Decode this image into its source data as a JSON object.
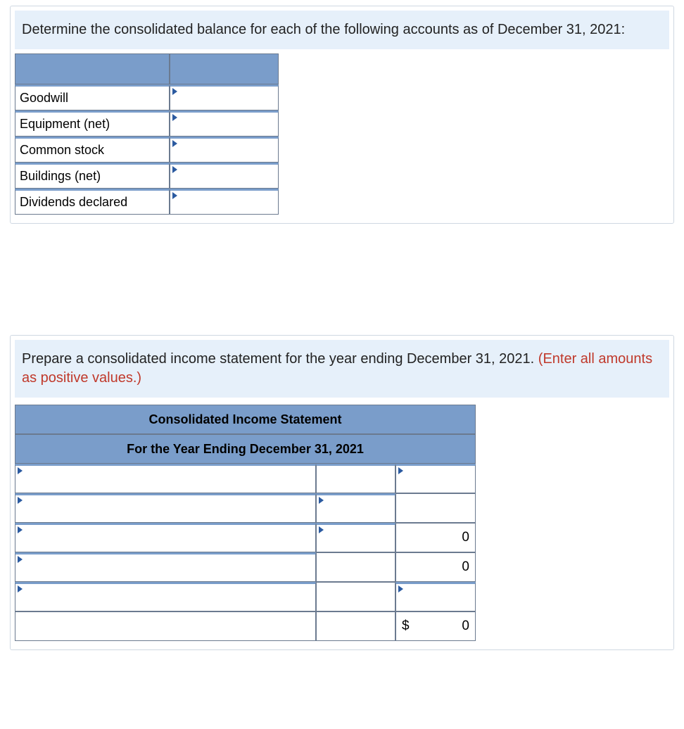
{
  "section1": {
    "instruction": "Determine the consolidated balance for each of the following accounts as of December 31, 2021:",
    "rows": [
      {
        "label": "Goodwill"
      },
      {
        "label": "Equipment (net)"
      },
      {
        "label": "Common stock"
      },
      {
        "label": "Buildings (net)"
      },
      {
        "label": "Dividends declared"
      }
    ]
  },
  "section2": {
    "instruction_main": "Prepare a consolidated income statement for the year ending December 31, 2021. ",
    "instruction_red": "(Enter all amounts as positive values.)",
    "header1": "Consolidated Income Statement",
    "header2": "For the Year Ending December 31, 2021",
    "rows": [
      {
        "desc_caret": true,
        "amt1_caret": false,
        "amt2_caret": true,
        "amt2_val": ""
      },
      {
        "desc_caret": true,
        "amt1_caret": true,
        "amt2_caret": false,
        "amt2_val": ""
      },
      {
        "desc_caret": true,
        "amt1_caret": true,
        "amt2_caret": false,
        "amt2_val": "0"
      },
      {
        "desc_caret": true,
        "amt1_caret": false,
        "amt2_caret": false,
        "amt2_val": "0"
      },
      {
        "desc_caret": true,
        "amt1_caret": false,
        "amt2_caret": true,
        "amt2_val": ""
      },
      {
        "desc_caret": false,
        "amt1_caret": false,
        "amt2_caret": false,
        "amt2_val": "0",
        "dollar": "$"
      }
    ]
  }
}
